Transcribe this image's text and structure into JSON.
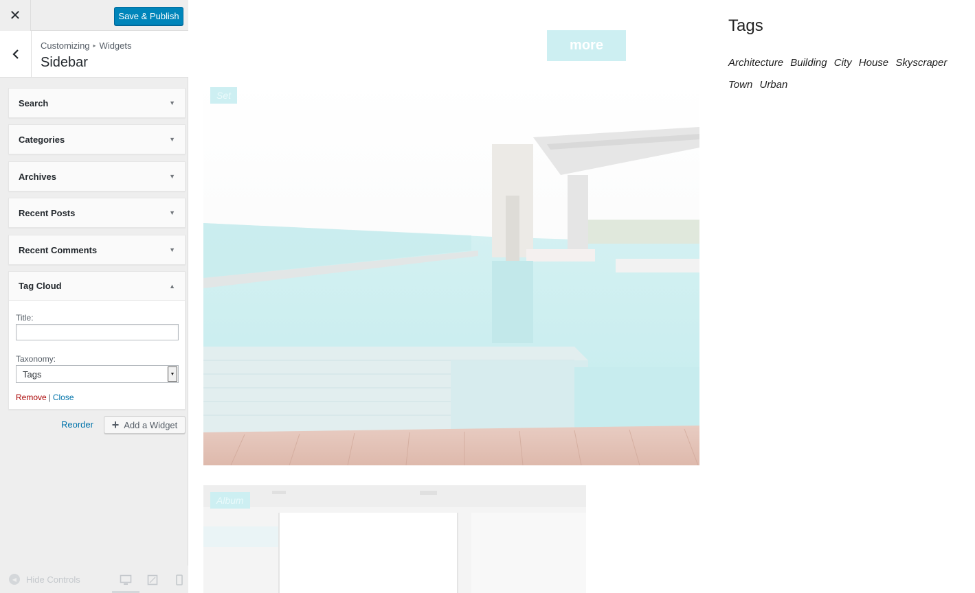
{
  "customizer": {
    "close_icon": "close-icon",
    "publish_label": "Save & Publish",
    "breadcrumb": {
      "parent": "Customizing",
      "child": "Widgets"
    },
    "section_title": "Sidebar",
    "widgets": [
      {
        "label": "Search"
      },
      {
        "label": "Categories"
      },
      {
        "label": "Archives"
      },
      {
        "label": "Recent Posts"
      },
      {
        "label": "Recent Comments"
      },
      {
        "label": "Tag Cloud"
      }
    ],
    "tag_cloud_form": {
      "title_label": "Title:",
      "title_value": "",
      "taxonomy_label": "Taxonomy:",
      "taxonomy_value": "Tags",
      "remove_label": "Remove",
      "separator": "|",
      "close_label": "Close"
    },
    "reorder_label": "Reorder",
    "add_widget_label": "Add a Widget",
    "hide_controls_label": "Hide Controls",
    "colors": {
      "primary": "#0085ba",
      "link": "#0073aa",
      "remove": "#aa0000"
    }
  },
  "preview": {
    "more_label": "more",
    "posts": [
      {
        "badge": "Set"
      },
      {
        "badge": "Album"
      }
    ],
    "tags_title": "Tags",
    "tags": [
      "Architecture",
      "Building",
      "City",
      "House",
      "Skyscraper",
      "Town",
      "Urban"
    ],
    "colors": {
      "accent": "#cdeff2"
    }
  }
}
